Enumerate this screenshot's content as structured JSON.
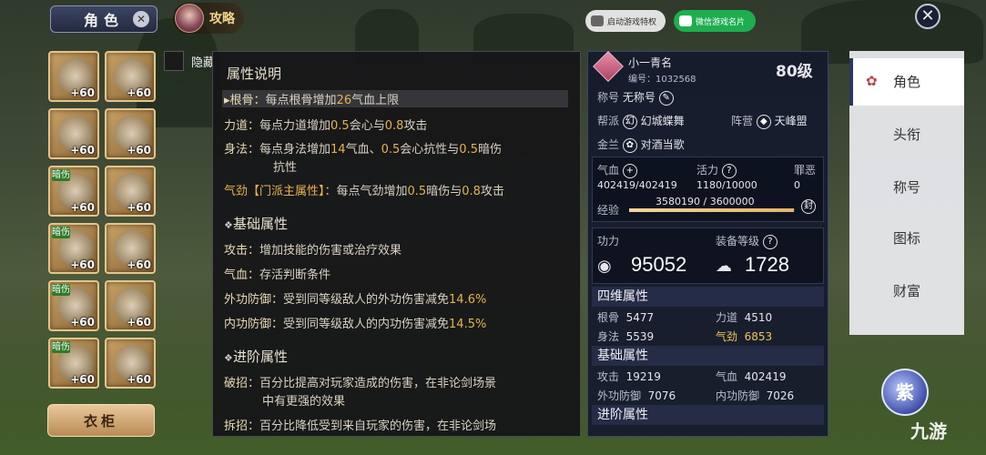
{
  "header": {
    "role_tab": "角色",
    "strategy_label": "攻略",
    "launch_privilege": "启动游戏特权",
    "wechat_card": "微信游戏名片"
  },
  "equipment": {
    "hide_label": "隐藏",
    "wardrobe": "衣柜",
    "slots": [
      {
        "plus": "+60",
        "tag": ""
      },
      {
        "plus": "+60",
        "tag": ""
      },
      {
        "plus": "+60",
        "tag": ""
      },
      {
        "plus": "+60",
        "tag": ""
      },
      {
        "plus": "+60",
        "tag": "暗伤"
      },
      {
        "plus": "+60",
        "tag": ""
      },
      {
        "plus": "+60",
        "tag": "暗伤"
      },
      {
        "plus": "+60",
        "tag": ""
      },
      {
        "plus": "+60",
        "tag": "暗伤"
      },
      {
        "plus": "+60",
        "tag": ""
      },
      {
        "plus": "+60",
        "tag": "暗伤"
      },
      {
        "plus": "+60",
        "tag": ""
      }
    ]
  },
  "attr_desc": {
    "title": "属性说明",
    "gengu": {
      "label": "▸根骨：",
      "pre": "每点根骨增加",
      "num": "26",
      "post": "气血上限"
    },
    "lidao": {
      "label": "力道：",
      "pre": "每点力道增加",
      "n1": "0.5",
      "mid": "会心与",
      "n2": "0.8",
      "post": "攻击"
    },
    "shenfa": {
      "label": "身法：",
      "pre": "每点身法增加",
      "n1": "14",
      "mid1": "气血、",
      "n2": "0.5",
      "mid2": "会心抗性与",
      "n3": "0.5",
      "post": "暗伤"
    },
    "shenfa_cont": "抗性",
    "qijin": {
      "label": "气劲【门派主属性】：",
      "pre": "每点气劲增加",
      "n1": "0.5",
      "mid": "暗伤与",
      "n2": "0.8",
      "post": "攻击"
    },
    "basic_title": "基础属性",
    "attack": {
      "label": "攻击：",
      "text": "增加技能的伤害或治疗效果"
    },
    "qixue": {
      "label": "气血：",
      "text": "存活判断条件"
    },
    "outer_def": {
      "label": "外功防御：",
      "text": "受到同等级敌人的外功伤害减免",
      "num": "14.6%"
    },
    "inner_def": {
      "label": "内功防御：",
      "text": "受到同等级敌人的内功伤害减免",
      "num": "14.5%"
    },
    "adv_title": "进阶属性",
    "pozhao": {
      "label": "破招：",
      "text": "百分比提高对玩家造成的伤害，在非论剑场景"
    },
    "pozhao_cont": "中有更强的效果",
    "chaizhao": {
      "label": "拆招：",
      "text": "百分比降低受到来自玩家的伤害，在非论剑场"
    }
  },
  "character": {
    "name": "小一青名",
    "id_label": "编号：1032568",
    "level": "80级",
    "title_label": "称号",
    "title_value": "无称号",
    "guild_label": "帮派",
    "guild_value": "幻城蝶舞",
    "camp_label": "阵营",
    "camp_value": "天峰盟",
    "jinlan_label": "金兰",
    "jinlan_value": "对酒当歌",
    "qixue_label": "气血",
    "qixue_value": "402419/402419",
    "huoli_label": "活力",
    "huoli_value": "1180/10000",
    "zui_label": "罪恶",
    "zui_value": "0",
    "xp_label": "经验",
    "xp_value": "3580190 / 3600000",
    "xp_ratio": 0.9945,
    "feng": "封",
    "power_label": "功力",
    "power_value": "95052",
    "equip_label": "装备等级",
    "equip_value": "1728",
    "four_title": "四维属性",
    "gengu_label": "根骨",
    "gengu_value": "5477",
    "lidao_label": "力道",
    "lidao_value": "4510",
    "shenfa_label": "身法",
    "shenfa_value": "5539",
    "qijin_label": "气劲",
    "qijin_value": "6853",
    "basic_title": "基础属性",
    "attack_label": "攻击",
    "attack_value": "19219",
    "qixue2_label": "气血",
    "qixue2_value": "402419",
    "outer_label": "外功防御",
    "outer_value": "7076",
    "inner_label": "内功防御",
    "inner_value": "7026",
    "adv_title": "进阶属性"
  },
  "nav": {
    "items": [
      "角色",
      "头衔",
      "称号",
      "图标",
      "财富"
    ]
  },
  "badge": {
    "zi": "紫"
  },
  "watermark": "九游"
}
